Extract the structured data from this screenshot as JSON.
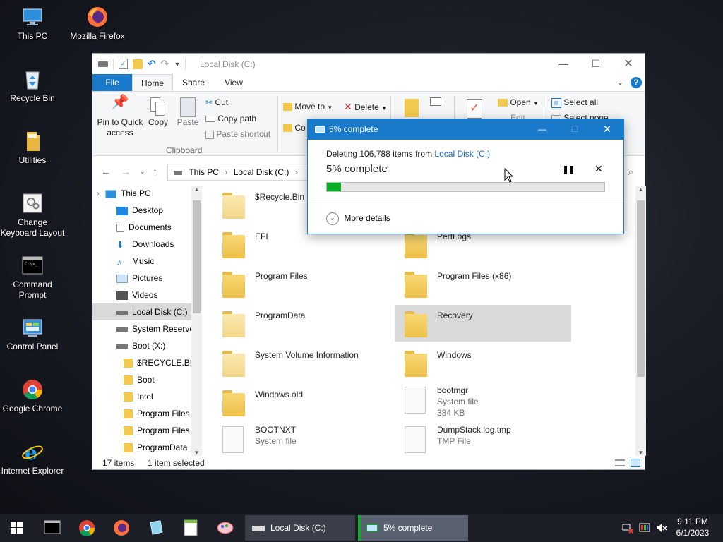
{
  "desktop": {
    "icons": [
      {
        "label": "This PC"
      },
      {
        "label": "Mozilla Firefox"
      },
      {
        "label": "Recycle Bin"
      },
      {
        "label": "Utilities"
      },
      {
        "label_line1": "Change",
        "label_line2": "Keyboard Layout"
      },
      {
        "label_line1": "Command",
        "label_line2": "Prompt"
      },
      {
        "label": "Control Panel"
      },
      {
        "label": "Google Chrome"
      },
      {
        "label": "Internet Explorer"
      }
    ]
  },
  "explorer": {
    "title": "Local Disk (C:)",
    "tabs": {
      "file": "File",
      "home": "Home",
      "share": "Share",
      "view": "View"
    },
    "ribbon": {
      "pin_line1": "Pin to Quick",
      "pin_line2": "access",
      "copy": "Copy",
      "paste": "Paste",
      "cut": "Cut",
      "copy_path": "Copy path",
      "paste_shortcut": "Paste shortcut",
      "clipboard_group": "Clipboard",
      "move_to": "Move to",
      "delete": "Delete",
      "copy_to": "Co",
      "open": "Open",
      "edit": "Edit",
      "select_all": "Select all",
      "select_none": "Select none"
    },
    "address": {
      "this_pc": "This PC",
      "local_disk": "Local Disk (C:)",
      "sep": "›"
    },
    "nav": [
      {
        "label": "This PC"
      },
      {
        "label": "Desktop"
      },
      {
        "label": "Documents"
      },
      {
        "label": "Downloads"
      },
      {
        "label": "Music"
      },
      {
        "label": "Pictures"
      },
      {
        "label": "Videos"
      },
      {
        "label": "Local Disk (C:)"
      },
      {
        "label": "System Reserve"
      },
      {
        "label": "Boot (X:)"
      },
      {
        "label": "$RECYCLE.BIN"
      },
      {
        "label": "Boot"
      },
      {
        "label": "Intel"
      },
      {
        "label": "Program Files"
      },
      {
        "label": "Program Files"
      },
      {
        "label": "ProgramData"
      }
    ],
    "items": [
      {
        "name": "$Recycle.Bin"
      },
      {
        "name": "EFI"
      },
      {
        "name": "PerfLogs"
      },
      {
        "name": "Program Files"
      },
      {
        "name": "Program Files (x86)"
      },
      {
        "name": "ProgramData"
      },
      {
        "name": "Recovery"
      },
      {
        "name": "System Volume Information"
      },
      {
        "name": "Windows"
      },
      {
        "name": "Windows.old"
      },
      {
        "name": "bootmgr",
        "type": "System file",
        "size": "384 KB"
      },
      {
        "name": "BOOTNXT",
        "type": "System file"
      },
      {
        "name": "DumpStack.log.tmp",
        "type": "TMP File"
      }
    ],
    "status": {
      "count": "17 items",
      "selected": "1 item selected"
    }
  },
  "dialog": {
    "title": "5% complete",
    "deleting_prefix": "Deleting 106,788 items from",
    "deleting_link": "Local Disk (C:)",
    "heading": "5% complete",
    "progress_fraction": 0.05,
    "more_details": "More details"
  },
  "taskbar": {
    "task_explorer": "Local Disk (C:)",
    "task_progress": "5% complete",
    "time": "9:11 PM",
    "date": "6/1/2023"
  },
  "colors": {
    "accent": "#1979ca",
    "progress": "#06b025",
    "folder": "#f0c24f"
  }
}
